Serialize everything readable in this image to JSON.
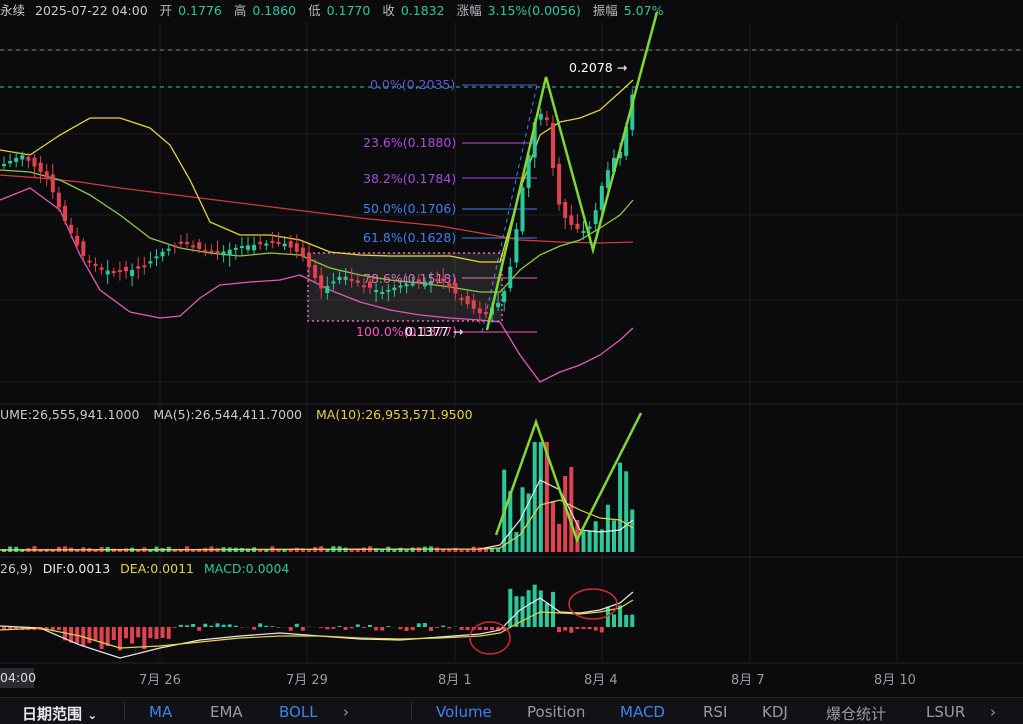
{
  "header": {
    "symbol": "永续",
    "datetime": "2025-07-22 04:00",
    "open_label": "开",
    "open_value": "0.1776",
    "high_label": "高",
    "high_value": "0.1860",
    "low_label": "低",
    "low_value": "0.1770",
    "close_label": "收",
    "close_value": "0.1832",
    "change_label": "涨幅",
    "change_value": "3.15%(0.0056)",
    "amplitude_label": "振幅",
    "amplitude_value": "5.07%"
  },
  "main_chart": {
    "fib_levels": [
      {
        "label": "0.0%(0.2035)",
        "color": "#5b5bd6"
      },
      {
        "label": "23.6%(0.1880)",
        "color": "#b04bdc"
      },
      {
        "label": "38.2%(0.1784)",
        "color": "#a34de0"
      },
      {
        "label": "50.0%(0.1706)",
        "color": "#3d82f0"
      },
      {
        "label": "61.8%(0.1628)",
        "color": "#3d82f0"
      },
      {
        "label": "78.6%(0.1518)",
        "color": "#e06ab8"
      },
      {
        "label": "100.0%(0.1377)",
        "color": "#ff55c8"
      }
    ],
    "price_high_tag": "0.2078 →",
    "price_low_tag": "0.1377 →"
  },
  "volume_panel": {
    "volume_label": "UME:26,555,941.1000",
    "ma5_label": "MA(5):26,544,411.7000",
    "ma10_label": "MA(10):26,953,571.9500"
  },
  "macd_panel": {
    "params_label": "26,9)",
    "dif_label": "DIF:0.0013",
    "dea_label": "DEA:0.0011",
    "macd_label": "MACD:0.0004"
  },
  "x_axis": {
    "cursor_tag": "04:00",
    "ticks": [
      "7月 26",
      "7月 29",
      "8月 1",
      "8月 4",
      "8月 7",
      "8月 10"
    ]
  },
  "toolbar": {
    "date_range": "日期范围",
    "date_range_caret": "⌄",
    "ma": "MA",
    "ema": "EMA",
    "boll": "BOLL",
    "more_left": "›",
    "volume": "Volume",
    "position": "Position",
    "macd": "MACD",
    "rsi": "RSI",
    "kdj": "KDJ",
    "liquidation": "爆仓统计",
    "lsur": "LSUR",
    "more_right": "›"
  },
  "colors": {
    "up": "#2ec79a",
    "down": "#e0424f",
    "boll_mid": "#8ecb3f",
    "boll_upper": "#e6d340",
    "boll_lower": "#e05ab8",
    "ma_red": "#d33a3a",
    "drawing_green": "#7fd833"
  }
}
